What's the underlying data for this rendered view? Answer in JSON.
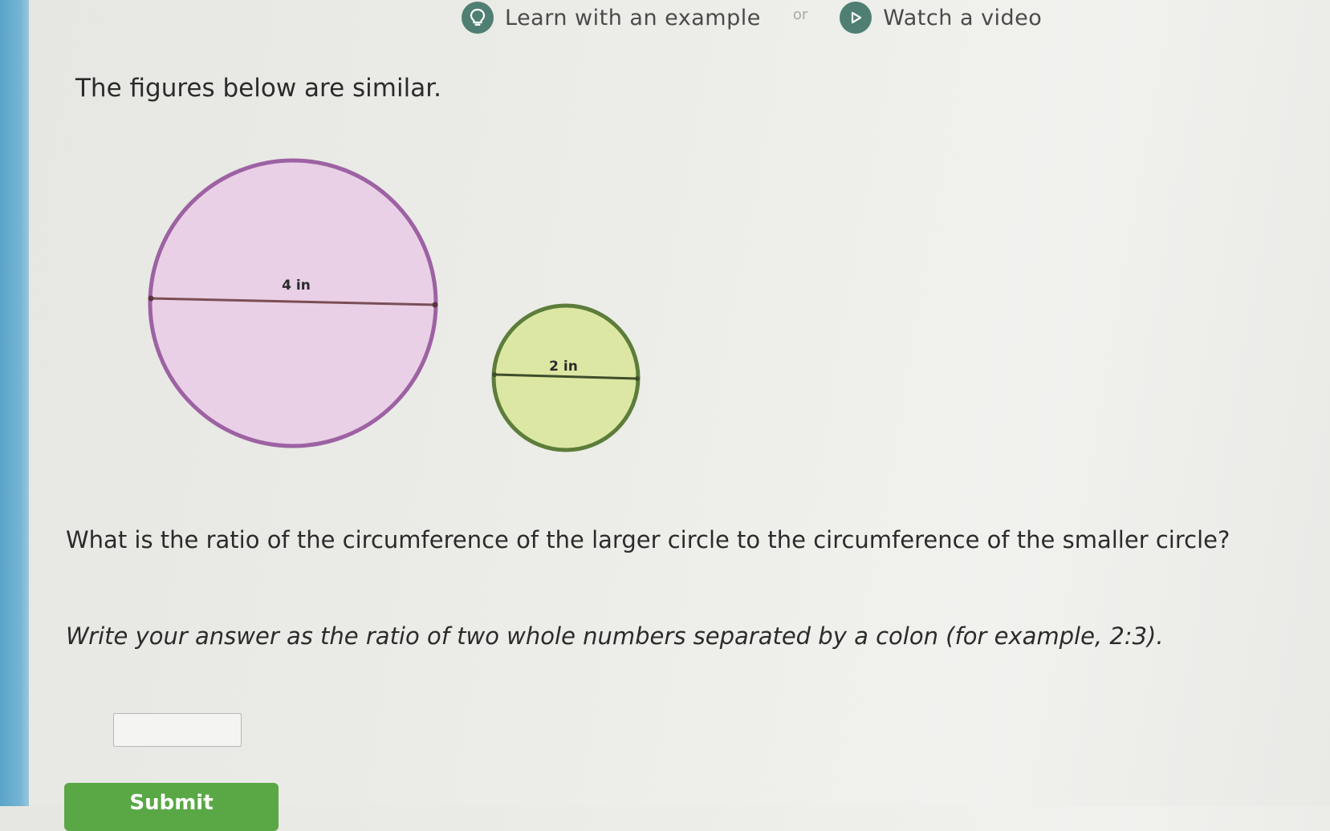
{
  "help_bar": {
    "example_label": "Learn with an example",
    "or_label": "or",
    "video_label": "Watch a video",
    "icon_color": "#4f7f72"
  },
  "problem": {
    "intro": "The figures below are similar.",
    "question": "What is the ratio of the circumference of the larger circle to the circumference of the smaller circle?",
    "instructions": "Write your answer as the ratio of two whole numbers separated by a colon (for example, 2:3)."
  },
  "figures": {
    "large_circle": {
      "label": "4 in",
      "fill": "#ead0e6",
      "stroke": "#9d62a3"
    },
    "small_circle": {
      "label": "2 in",
      "fill": "#dde7a4",
      "stroke": "#5d7d3a"
    }
  },
  "answer": {
    "value": "",
    "placeholder": ""
  },
  "submit": {
    "label": "Submit",
    "color": "#59a845"
  }
}
